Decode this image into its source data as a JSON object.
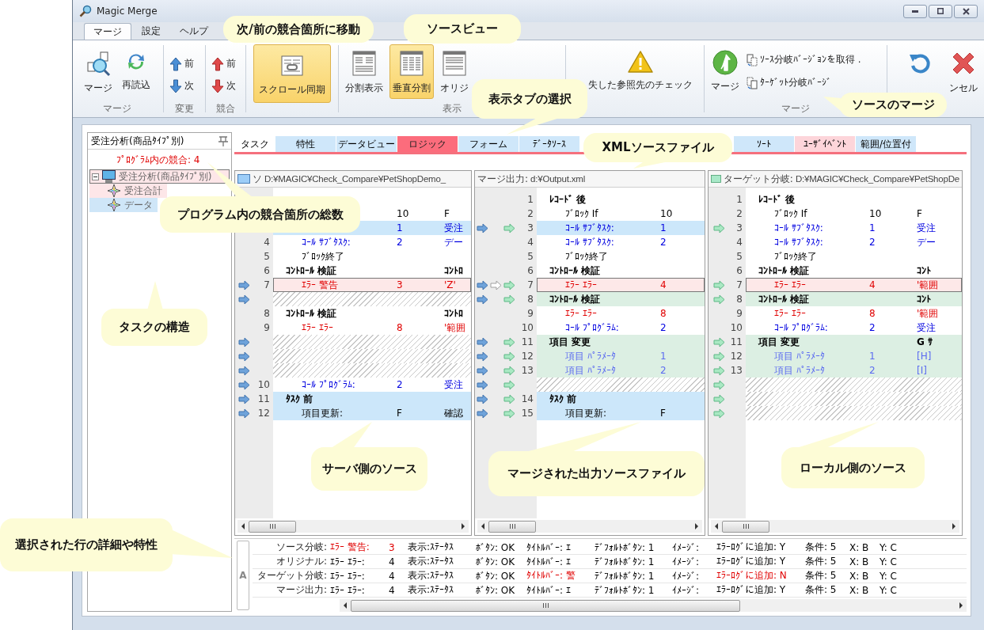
{
  "window": {
    "title": "Magic Merge"
  },
  "ribbon_tabs": [
    {
      "label": "マージ",
      "selected": true
    },
    {
      "label": "設定",
      "selected": false
    },
    {
      "label": "ヘルプ",
      "selected": false
    }
  ],
  "ribbon": {
    "merge_group": {
      "label": "マージ",
      "merge": "マージ",
      "reload": "再読込"
    },
    "change_group": {
      "label": "変更",
      "prev": "前",
      "next": "次"
    },
    "conflict_group": {
      "label": "競合",
      "prev": "前",
      "next": "次"
    },
    "scroll_sync": {
      "label": "スクロール同期",
      "selected": true
    },
    "view_group": {
      "label": "表示",
      "buttons": [
        {
          "label": "分割表示",
          "selected": false
        },
        {
          "label": "垂直分割",
          "selected": true
        },
        {
          "label": "オリジ",
          "selected": false
        }
      ]
    },
    "check_button": {
      "label": "失した参照先のチェック"
    },
    "merge_actions": {
      "label": "マージ",
      "merge": "マージ",
      "get_source": "ｿｰｽ分岐ﾊﾞｰｼﾞｮﾝを取得 .",
      "get_target": "ﾀｰｹﾞｯﾄ分岐ﾊﾞｰｼﾞ"
    },
    "cancel_button": {
      "label": "ンセル"
    }
  },
  "tree": {
    "header": "受注分析(商品ﾀｲﾌﾟ別)",
    "conflict_count": "ﾌﾟﾛｸﾞﾗﾑ内の競合: 4",
    "items": [
      {
        "label": "受注分析(商品ﾀｲﾌﾟ別)",
        "changed": false,
        "conflict": true,
        "selected": true,
        "expanded": true,
        "children": [
          {
            "label": "受注合計",
            "changed": false,
            "conflict": true,
            "selected": false
          },
          {
            "label": "データ",
            "changed": true,
            "conflict": false,
            "selected": false
          }
        ]
      }
    ]
  },
  "section_tabs": [
    {
      "label": "タスク",
      "changed": false,
      "conflict": false,
      "selected": false
    },
    {
      "label": "特性",
      "changed": true,
      "conflict": false,
      "selected": false
    },
    {
      "label": "データビュー",
      "changed": true,
      "conflict": false,
      "selected": false
    },
    {
      "label": "ロジック",
      "changed": false,
      "conflict": true,
      "selected": true
    },
    {
      "label": "フォーム",
      "changed": true,
      "conflict": false,
      "selected": false
    },
    {
      "label": "ﾃﾞｰﾀｿｰｽ",
      "changed": true,
      "conflict": false,
      "selected": false
    },
    {
      "label": "ｿｰﾄ",
      "changed": true,
      "conflict": false,
      "selected": false
    },
    {
      "label": "ﾕｰｻﾞｲﾍﾞﾝﾄ",
      "changed": false,
      "conflict": true,
      "selected": false
    },
    {
      "label": "範囲/位置付",
      "changed": true,
      "conflict": false,
      "selected": false
    }
  ],
  "panes": [
    {
      "kind": "source",
      "title": "ソ",
      "path": "D:¥MAGIC¥Check_Compare¥PetShopDemo_",
      "rows": [
        {
          "value": "10",
          "extra": "F",
          "kind": "plain",
          "changed": false,
          "conflict": false,
          "added": false,
          "selected": false
        },
        {
          "value": "1",
          "extra": "受注",
          "kind": "call",
          "changed": true,
          "conflict": false,
          "added": false,
          "selected": false
        },
        {
          "num": "4",
          "label": "ｺｰﾙ ｻﾌﾞﾀｽｸ:",
          "value": "2",
          "extra": "デー",
          "kind": "call",
          "changed": false,
          "conflict": false,
          "added": false,
          "selected": false
        },
        {
          "num": "5",
          "label": "ﾌﾞﾛｯｸ終了",
          "kind": "plain",
          "changed": false,
          "conflict": false,
          "added": false,
          "selected": false
        },
        {
          "num": "6",
          "label": "ｺﾝﾄﾛｰﾙ 検証",
          "extra": "ｺﾝﾄﾛ",
          "kind": "bold",
          "changed": false,
          "conflict": false,
          "added": false,
          "selected": false
        },
        {
          "num": "7",
          "label": "ｴﾗｰ 警告",
          "value": "3",
          "extra": "'Z'",
          "kind": "error",
          "changed": false,
          "conflict": true,
          "added": false,
          "selected": true,
          "arrows": [
            {
              "kind": "source"
            }
          ]
        },
        {
          "kind": "gap",
          "changed": false,
          "conflict": false,
          "added": false,
          "selected": false,
          "arrows": [
            {
              "kind": "source"
            }
          ]
        },
        {
          "num": "8",
          "label": "ｺﾝﾄﾛｰﾙ 検証",
          "extra": "ｺﾝﾄﾛ",
          "kind": "bold",
          "changed": false,
          "conflict": false,
          "added": false,
          "selected": false
        },
        {
          "num": "9",
          "label": "ｴﾗｰ ｴﾗｰ",
          "value": "8",
          "extra": "'範囲",
          "kind": "error",
          "changed": false,
          "conflict": false,
          "added": false,
          "selected": false
        },
        {
          "kind": "gap",
          "changed": false,
          "conflict": false,
          "added": false,
          "selected": false,
          "arrows": [
            {
              "kind": "source"
            }
          ]
        },
        {
          "kind": "gap",
          "changed": false,
          "conflict": false,
          "added": false,
          "selected": false,
          "arrows": [
            {
              "kind": "source"
            }
          ]
        },
        {
          "kind": "gap",
          "changed": false,
          "conflict": false,
          "added": false,
          "selected": false,
          "arrows": [
            {
              "kind": "source"
            }
          ]
        },
        {
          "num": "10",
          "label": "ｺｰﾙ ﾌﾟﾛｸﾞﾗﾑ:",
          "value": "2",
          "extra": "受注",
          "kind": "call",
          "changed": false,
          "conflict": false,
          "added": false,
          "selected": false,
          "arrows": [
            {
              "kind": "source"
            }
          ]
        },
        {
          "num": "11",
          "label": "ﾀｽｸ 前",
          "kind": "bold",
          "changed": true,
          "conflict": false,
          "added": false,
          "selected": false,
          "arrows": [
            {
              "kind": "source"
            }
          ]
        },
        {
          "num": "12",
          "label": "項目更新:",
          "value": "F",
          "extra": "確認",
          "kind": "plain",
          "changed": true,
          "conflict": false,
          "added": false,
          "selected": false,
          "arrows": [
            {
              "kind": "source"
            }
          ]
        }
      ]
    },
    {
      "kind": "output",
      "title": "マージ出力:",
      "path": "d:¥Output.xml",
      "rows": [
        {
          "num": "1",
          "label": "ﾚｺｰﾄﾞ 後",
          "kind": "bold",
          "changed": false,
          "conflict": false,
          "added": false,
          "selected": false
        },
        {
          "num": "2",
          "label": "ﾌﾞﾛｯｸ If",
          "value": "10",
          "kind": "plain",
          "changed": false,
          "conflict": false,
          "added": false,
          "selected": false
        },
        {
          "num": "3",
          "label": "ｺｰﾙ ｻﾌﾞﾀｽｸ:",
          "value": "1",
          "kind": "call",
          "changed": true,
          "conflict": false,
          "added": false,
          "selected": false,
          "arrows": [
            {
              "kind": "source"
            },
            {
              "kind": "target"
            }
          ]
        },
        {
          "num": "4",
          "label": "ｺｰﾙ ｻﾌﾞﾀｽｸ:",
          "value": "2",
          "kind": "call",
          "changed": false,
          "conflict": false,
          "added": false,
          "selected": false
        },
        {
          "num": "5",
          "label": "ﾌﾞﾛｯｸ終了",
          "kind": "plain",
          "changed": false,
          "conflict": false,
          "added": false,
          "selected": false
        },
        {
          "num": "6",
          "label": "ｺﾝﾄﾛｰﾙ 検証",
          "kind": "bold",
          "changed": false,
          "conflict": false,
          "added": false,
          "selected": false
        },
        {
          "num": "7",
          "label": "ｴﾗｰ ｴﾗｰ",
          "value": "4",
          "kind": "error",
          "changed": false,
          "conflict": true,
          "added": false,
          "selected": true,
          "arrows": [
            {
              "kind": "source"
            },
            {
              "kind": "reset"
            },
            {
              "kind": "target"
            }
          ]
        },
        {
          "num": "8",
          "label": "ｺﾝﾄﾛｰﾙ 検証",
          "kind": "bold",
          "changed": false,
          "conflict": false,
          "added": true,
          "selected": false,
          "arrows": [
            {
              "kind": "source"
            },
            {
              "kind": "target"
            }
          ]
        },
        {
          "num": "9",
          "label": "ｴﾗｰ ｴﾗｰ",
          "value": "8",
          "kind": "error",
          "changed": false,
          "conflict": false,
          "added": false,
          "selected": false
        },
        {
          "num": "10",
          "label": "ｺｰﾙ ﾌﾟﾛｸﾞﾗﾑ:",
          "value": "2",
          "kind": "call",
          "changed": false,
          "conflict": false,
          "added": false,
          "selected": false
        },
        {
          "num": "11",
          "label": "項目 変更",
          "kind": "bold",
          "changed": false,
          "conflict": false,
          "added": true,
          "selected": false,
          "arrows": [
            {
              "kind": "source"
            },
            {
              "kind": "target"
            }
          ]
        },
        {
          "num": "12",
          "label": "項目 ﾊﾟﾗﾒｰﾀ",
          "value": "1",
          "kind": "param",
          "changed": false,
          "conflict": false,
          "added": true,
          "selected": false,
          "arrows": [
            {
              "kind": "source"
            },
            {
              "kind": "target"
            }
          ]
        },
        {
          "num": "13",
          "label": "項目 ﾊﾟﾗﾒｰﾀ",
          "value": "2",
          "kind": "param",
          "changed": false,
          "conflict": false,
          "added": true,
          "selected": false,
          "arrows": [
            {
              "kind": "source"
            },
            {
              "kind": "target"
            }
          ]
        },
        {
          "kind": "gap",
          "changed": false,
          "conflict": false,
          "added": false,
          "selected": false,
          "arrows": [
            {
              "kind": "source"
            },
            {
              "kind": "target"
            }
          ]
        },
        {
          "num": "14",
          "label": "ﾀｽｸ 前",
          "kind": "bold",
          "changed": true,
          "conflict": false,
          "added": false,
          "selected": false,
          "arrows": [
            {
              "kind": "source"
            },
            {
              "kind": "target"
            }
          ]
        },
        {
          "num": "15",
          "label": "項目更新:",
          "value": "F",
          "kind": "plain",
          "changed": true,
          "conflict": false,
          "added": false,
          "selected": false,
          "arrows": [
            {
              "kind": "source"
            },
            {
              "kind": "target"
            }
          ]
        }
      ]
    },
    {
      "kind": "target",
      "title": "ターゲット分岐:",
      "path": "D:¥MAGIC¥Check_Compare¥PetShopDe",
      "rows": [
        {
          "num": "1",
          "label": "ﾚｺｰﾄﾞ 後",
          "kind": "bold",
          "changed": false,
          "conflict": false,
          "added": false,
          "selected": false
        },
        {
          "num": "2",
          "label": "ﾌﾞﾛｯｸ If",
          "value": "10",
          "extra": "F",
          "kind": "plain",
          "changed": false,
          "conflict": false,
          "added": false,
          "selected": false
        },
        {
          "num": "3",
          "label": "ｺｰﾙ ｻﾌﾞﾀｽｸ:",
          "value": "1",
          "extra": "受注",
          "kind": "call",
          "changed": false,
          "conflict": false,
          "added": false,
          "selected": false,
          "arrows": [
            {
              "kind": "target"
            }
          ]
        },
        {
          "num": "4",
          "label": "ｺｰﾙ ｻﾌﾞﾀｽｸ:",
          "value": "2",
          "extra": "デー",
          "kind": "call",
          "changed": false,
          "conflict": false,
          "added": false,
          "selected": false
        },
        {
          "num": "5",
          "label": "ﾌﾞﾛｯｸ終了",
          "kind": "plain",
          "changed": false,
          "conflict": false,
          "added": false,
          "selected": false
        },
        {
          "num": "6",
          "label": "ｺﾝﾄﾛｰﾙ 検証",
          "extra": "ｺﾝﾄ",
          "kind": "bold",
          "changed": false,
          "conflict": false,
          "added": false,
          "selected": false
        },
        {
          "num": "7",
          "label": "ｴﾗｰ ｴﾗｰ",
          "value": "4",
          "extra": "'範囲",
          "kind": "error",
          "changed": false,
          "conflict": true,
          "added": false,
          "selected": true,
          "arrows": [
            {
              "kind": "target"
            }
          ]
        },
        {
          "num": "8",
          "label": "ｺﾝﾄﾛｰﾙ 検証",
          "extra": "ｺﾝﾄ",
          "kind": "bold",
          "changed": false,
          "conflict": false,
          "added": true,
          "selected": false,
          "arrows": [
            {
              "kind": "target"
            }
          ]
        },
        {
          "num": "9",
          "label": "ｴﾗｰ ｴﾗｰ",
          "value": "8",
          "extra": "'範囲",
          "kind": "error",
          "changed": false,
          "conflict": false,
          "added": false,
          "selected": false
        },
        {
          "num": "10",
          "label": "ｺｰﾙ ﾌﾟﾛｸﾞﾗﾑ:",
          "value": "2",
          "extra": "受注",
          "kind": "call",
          "changed": false,
          "conflict": false,
          "added": false,
          "selected": false
        },
        {
          "num": "11",
          "label": "項目 変更",
          "extra": "G ｻ",
          "kind": "bold",
          "changed": false,
          "conflict": false,
          "added": true,
          "selected": false,
          "arrows": [
            {
              "kind": "target"
            }
          ]
        },
        {
          "num": "12",
          "label": "項目 ﾊﾟﾗﾒｰﾀ",
          "value": "1",
          "extra": "[H]",
          "kind": "param",
          "changed": false,
          "conflict": false,
          "added": true,
          "selected": false,
          "arrows": [
            {
              "kind": "target"
            }
          ]
        },
        {
          "num": "13",
          "label": "項目 ﾊﾟﾗﾒｰﾀ",
          "value": "2",
          "extra": "[I]",
          "kind": "param",
          "changed": false,
          "conflict": false,
          "added": true,
          "selected": false,
          "arrows": [
            {
              "kind": "target"
            }
          ]
        },
        {
          "kind": "gap",
          "changed": false,
          "conflict": false,
          "added": false,
          "selected": false,
          "arrows": [
            {
              "kind": "target"
            }
          ]
        },
        {
          "kind": "gap",
          "changed": false,
          "conflict": false,
          "added": false,
          "selected": false,
          "arrows": [
            {
              "kind": "target"
            }
          ]
        },
        {
          "kind": "gap",
          "changed": false,
          "conflict": false,
          "added": false,
          "selected": false,
          "arrows": [
            {
              "kind": "target"
            }
          ]
        }
      ]
    }
  ],
  "details": {
    "side_tab": "A",
    "rows": [
      {
        "label": "ソース分岐:",
        "cells": [
          {
            "text": "ｴﾗｰ 警告:",
            "conflict": true
          },
          {
            "text": "3",
            "conflict": true
          },
          {
            "text": "表示:ｽﾃｰﾀｽ",
            "conflict": false
          },
          {
            "text": "ﾎﾞﾀﾝ: OK",
            "conflict": false
          },
          {
            "text": "ﾀｲﾄﾙﾊﾞｰ: ｴ",
            "conflict": false
          },
          {
            "text": "ﾃﾞﾌｫﾙﾄﾎﾞﾀﾝ: 1",
            "conflict": false
          },
          {
            "text": "ｲﾒｰｼﾞ:",
            "conflict": false
          },
          {
            "text": "ｴﾗｰﾛｸﾞに追加: Y",
            "conflict": false
          },
          {
            "text": "条件: 5",
            "conflict": false
          },
          {
            "text": "X: B",
            "conflict": false
          },
          {
            "text": "Y: C",
            "conflict": false
          }
        ]
      },
      {
        "label": "オリジナル:",
        "cells": [
          {
            "text": "ｴﾗｰ ｴﾗｰ:",
            "conflict": false
          },
          {
            "text": "4",
            "conflict": false
          },
          {
            "text": "表示:ｽﾃｰﾀｽ",
            "conflict": false
          },
          {
            "text": "ﾎﾞﾀﾝ: OK",
            "conflict": false
          },
          {
            "text": "ﾀｲﾄﾙﾊﾞｰ: ｴ",
            "conflict": false
          },
          {
            "text": "ﾃﾞﾌｫﾙﾄﾎﾞﾀﾝ: 1",
            "conflict": false
          },
          {
            "text": "ｲﾒｰｼﾞ:",
            "conflict": false
          },
          {
            "text": "ｴﾗｰﾛｸﾞに追加: Y",
            "conflict": false
          },
          {
            "text": "条件: 5",
            "conflict": false
          },
          {
            "text": "X: B",
            "conflict": false
          },
          {
            "text": "Y: C",
            "conflict": false
          }
        ]
      },
      {
        "label": "ターゲット分岐:",
        "cells": [
          {
            "text": "ｴﾗｰ ｴﾗｰ:",
            "conflict": false
          },
          {
            "text": "4",
            "conflict": false
          },
          {
            "text": "表示:ｽﾃｰﾀｽ",
            "conflict": false
          },
          {
            "text": "ﾎﾞﾀﾝ: OK",
            "conflict": false
          },
          {
            "text": "ﾀｲﾄﾙﾊﾞｰ: 警",
            "conflict": true
          },
          {
            "text": "ﾃﾞﾌｫﾙﾄﾎﾞﾀﾝ: 1",
            "conflict": false
          },
          {
            "text": "ｲﾒｰｼﾞ:",
            "conflict": false
          },
          {
            "text": "ｴﾗｰﾛｸﾞに追加: N",
            "conflict": true
          },
          {
            "text": "条件: 5",
            "conflict": false
          },
          {
            "text": "X: B",
            "conflict": false
          },
          {
            "text": "Y: C",
            "conflict": false
          }
        ]
      },
      {
        "label": "マージ出力:",
        "cells": [
          {
            "text": "ｴﾗｰ ｴﾗｰ:",
            "conflict": false
          },
          {
            "text": "4",
            "conflict": false
          },
          {
            "text": "表示:ｽﾃｰﾀｽ",
            "conflict": false
          },
          {
            "text": "ﾎﾞﾀﾝ: OK",
            "conflict": false
          },
          {
            "text": "ﾀｲﾄﾙﾊﾞｰ: ｴ",
            "conflict": false
          },
          {
            "text": "ﾃﾞﾌｫﾙﾄﾎﾞﾀﾝ: 1",
            "conflict": false
          },
          {
            "text": "ｲﾒｰｼﾞ:",
            "conflict": false
          },
          {
            "text": "ｴﾗｰﾛｸﾞに追加: Y",
            "conflict": false
          },
          {
            "text": "条件: 5",
            "conflict": false
          },
          {
            "text": "X: B",
            "conflict": false
          },
          {
            "text": "Y: C",
            "conflict": false
          }
        ]
      }
    ]
  },
  "callouts": [
    {
      "text": "次/前の競合箇所に移動"
    },
    {
      "text": "ソースビュー"
    },
    {
      "text": "表示タブの選択"
    },
    {
      "text": "ソースのマージ"
    },
    {
      "text": "XMLソースファイル"
    },
    {
      "text": "プログラム内の競合箇所の総数"
    },
    {
      "text": "タスクの構造"
    },
    {
      "text": "サーバ側のソース"
    },
    {
      "text": "マージされた出力ソースファイル"
    },
    {
      "text": "ローカル側のソース"
    },
    {
      "text": "選択された行の詳細や特性"
    }
  ]
}
